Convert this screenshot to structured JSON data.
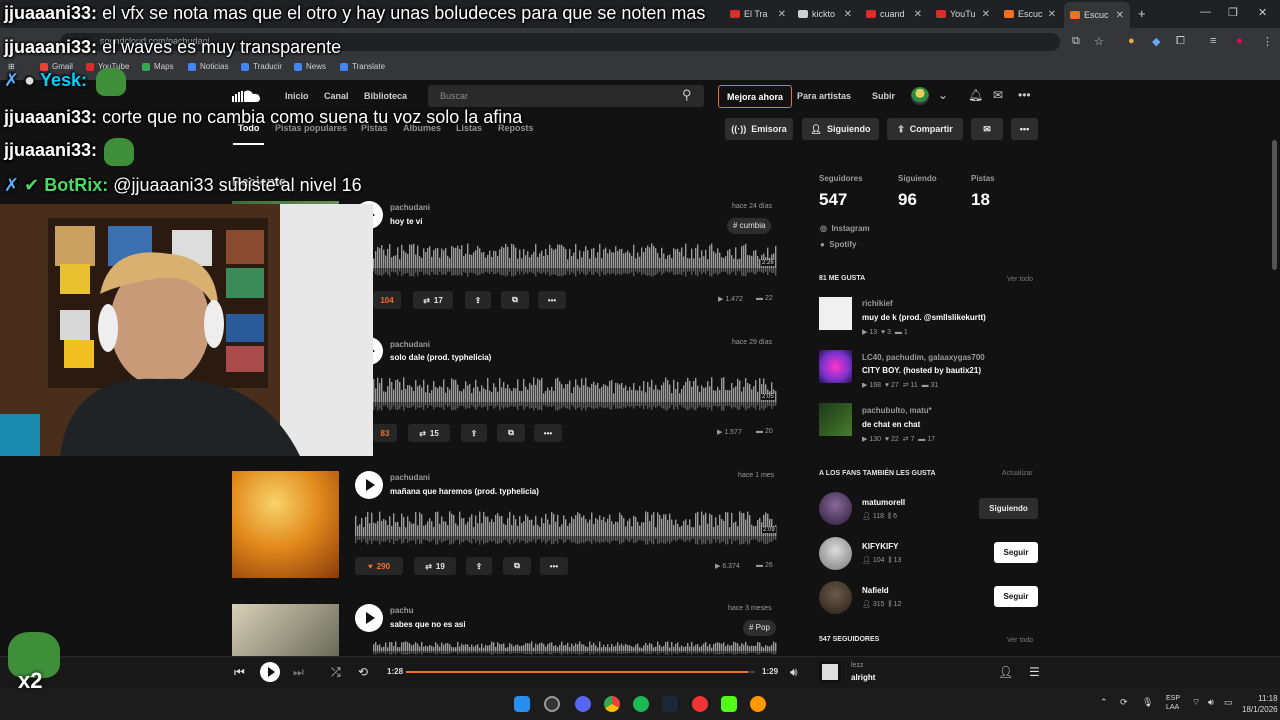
{
  "browser": {
    "tabs": [
      {
        "label": "El Tra",
        "color": "#e02b2b"
      },
      {
        "label": "kickto",
        "color": "#cfcfcf"
      },
      {
        "label": "cuand",
        "color": "#e02b2b"
      },
      {
        "label": "YouTu",
        "color": "#e02b2b"
      },
      {
        "label": "Escuc",
        "color": "#f26f23"
      },
      {
        "label": "Escuc",
        "color": "#f26f23"
      }
    ],
    "new_tab": "+",
    "url": "soundcloud.com/pachudani",
    "bookmarks": [
      "Gmail",
      "YouTube",
      "Maps",
      "Noticias",
      "Traducir",
      "News",
      "Translate"
    ]
  },
  "header": {
    "nav": [
      "Inicio",
      "Canal",
      "Biblioteca"
    ],
    "search_placeholder": "Buscar",
    "upgrade": "Mejora ahora",
    "artists": "Para artistas",
    "upload": "Subir"
  },
  "profile_tabs": [
    "Todo",
    "Pistas populares",
    "Pistas",
    "Álbumes",
    "Listas",
    "Reposts"
  ],
  "profile_actions": {
    "station": "Emisora",
    "following": "Siguiendo",
    "share": "Compartir"
  },
  "section_title": "Reciente",
  "tracks": [
    {
      "user": "pachudani",
      "title": "hoy te vi",
      "date": "hace 24 días",
      "tag": "# cumbia",
      "duration": "2:26",
      "likes": "104",
      "reposts": "17",
      "plays": "1.472",
      "comments": "22"
    },
    {
      "user": "pachudani",
      "title": "solo dale (prod. typhelicia)",
      "date": "hace 29 días",
      "tag": "",
      "duration": "2:05",
      "likes": "83",
      "reposts": "15",
      "plays": "1.577",
      "comments": "20"
    },
    {
      "user": "pachudani",
      "title": "mañana que haremos (prod. typhelicia)",
      "date": "hace 1 mes",
      "tag": "",
      "duration": "2:09",
      "likes": "290",
      "reposts": "19",
      "plays": "6.374",
      "comments": "26"
    },
    {
      "user": "pachu",
      "title": "sabes que no es asi",
      "date": "hace 3 meses",
      "tag": "# Pop",
      "duration": "",
      "likes": "",
      "reposts": "",
      "plays": "",
      "comments": ""
    }
  ],
  "sidebar": {
    "stats": [
      {
        "label": "Seguidores",
        "value": "547"
      },
      {
        "label": "Siguiendo",
        "value": "96"
      },
      {
        "label": "Pistas",
        "value": "18"
      }
    ],
    "links": [
      "Instagram",
      "Spotify"
    ],
    "likes_header": "81 ME GUSTA",
    "view_all": "Ver todo",
    "likes": [
      {
        "user": "richikief",
        "title": "muy de k (prod. @smllslikekurtt)",
        "plays": "13",
        "likes": "3",
        "comments": "1",
        "reposts": "",
        "c2": ""
      },
      {
        "user": "LC40, pachudim, galaaxygas700",
        "title": "CITY BOY. (hosted by bautix21)",
        "plays": "168",
        "likes": "27",
        "comments": "",
        "reposts": "11",
        "c2": "31"
      },
      {
        "user": "pachubulto, matu*",
        "title": "de chat en chat",
        "plays": "130",
        "likes": "22",
        "comments": "",
        "reposts": "7",
        "c2": "17"
      }
    ],
    "fans_header": "A LOS FANS TAMBIÉN LES GUSTA",
    "refresh": "Actualizar",
    "fans": [
      {
        "name": "matumorell",
        "followers": "118",
        "tracks": "6",
        "button": "Siguiendo"
      },
      {
        "name": "KIFYKIFY",
        "followers": "104",
        "tracks": "13",
        "button": "Seguir"
      },
      {
        "name": "Nafield",
        "followers": "315",
        "tracks": "12",
        "button": "Seguir"
      }
    ],
    "followers_header": "547 SEGUIDORES"
  },
  "player": {
    "elapsed": "1:28",
    "total": "1:29",
    "progress": 0.98,
    "user": "lezz",
    "title": "alright"
  },
  "taskbar": {
    "lang": "ESP",
    "lang2": "LAA",
    "time": "11:18",
    "date": "18/1/2026"
  },
  "overlay": {
    "chat": [
      {
        "user": "jjuaaani33:",
        "msg": "el vfx se nota mas que el otro y hay unas boludeces para que se noten mas"
      },
      {
        "user": "jjuaaani33:",
        "msg": "el waves es muy transparente"
      },
      {
        "user": "Yesk:",
        "msg": ""
      },
      {
        "user": "jjuaaani33:",
        "msg": "corte que no cambia como suena tu voz solo la afina"
      },
      {
        "user": "jjuaaani33:",
        "msg": ""
      },
      {
        "user": "BotRix:",
        "msg": "@jjuaaani33 subiste al nivel 16"
      }
    ],
    "multiplier": "x2"
  },
  "colors": {
    "accent": "#f26f23",
    "bg": "#121212",
    "botrix": "#4cd964",
    "yesk": "#00d2ff"
  }
}
